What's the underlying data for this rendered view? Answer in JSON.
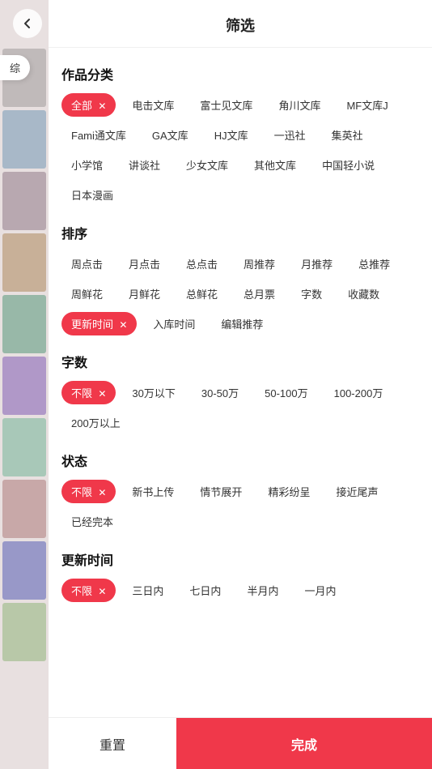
{
  "header": {
    "title": "筛选",
    "back_label": "‹"
  },
  "tab": {
    "label": "综"
  },
  "sections": {
    "category": {
      "title": "作品分类",
      "tags": [
        {
          "label": "全部",
          "active": true,
          "id": "all"
        },
        {
          "label": "电击文库",
          "active": false,
          "id": "dianji"
        },
        {
          "label": "富士见文库",
          "active": false,
          "id": "fuji"
        },
        {
          "label": "角川文库",
          "active": false,
          "id": "jiaochu"
        },
        {
          "label": "MF文库J",
          "active": false,
          "id": "mfj"
        },
        {
          "label": "Fami通文库",
          "active": false,
          "id": "fami"
        },
        {
          "label": "GA文库",
          "active": false,
          "id": "ga"
        },
        {
          "label": "HJ文库",
          "active": false,
          "id": "hj"
        },
        {
          "label": "一迅社",
          "active": false,
          "id": "yixun"
        },
        {
          "label": "集英社",
          "active": false,
          "id": "jiying"
        },
        {
          "label": "小学馆",
          "active": false,
          "id": "xiaoxue"
        },
        {
          "label": "讲谈社",
          "active": false,
          "id": "jiangtan"
        },
        {
          "label": "少女文库",
          "active": false,
          "id": "shaonv"
        },
        {
          "label": "其他文库",
          "active": false,
          "id": "qita"
        },
        {
          "label": "中国轻小说",
          "active": false,
          "id": "china"
        },
        {
          "label": "日本漫画",
          "active": false,
          "id": "manga"
        }
      ]
    },
    "sort": {
      "title": "排序",
      "tags": [
        {
          "label": "周点击",
          "active": false,
          "id": "week-click"
        },
        {
          "label": "月点击",
          "active": false,
          "id": "month-click"
        },
        {
          "label": "总点击",
          "active": false,
          "id": "total-click"
        },
        {
          "label": "周推荐",
          "active": false,
          "id": "week-rec"
        },
        {
          "label": "月推荐",
          "active": false,
          "id": "month-rec"
        },
        {
          "label": "总推荐",
          "active": false,
          "id": "total-rec"
        },
        {
          "label": "周鲜花",
          "active": false,
          "id": "week-flower"
        },
        {
          "label": "月鲜花",
          "active": false,
          "id": "month-flower"
        },
        {
          "label": "总鲜花",
          "active": false,
          "id": "total-flower"
        },
        {
          "label": "总月票",
          "active": false,
          "id": "total-ticket"
        },
        {
          "label": "字数",
          "active": false,
          "id": "wordcount"
        },
        {
          "label": "收藏数",
          "active": false,
          "id": "favorites"
        },
        {
          "label": "更新时间",
          "active": true,
          "id": "update-time"
        },
        {
          "label": "入库时间",
          "active": false,
          "id": "add-time"
        },
        {
          "label": "编辑推荐",
          "active": false,
          "id": "editor-rec"
        }
      ]
    },
    "wordcount": {
      "title": "字数",
      "tags": [
        {
          "label": "不限",
          "active": true,
          "id": "wc-all"
        },
        {
          "label": "30万以下",
          "active": false,
          "id": "wc-30"
        },
        {
          "label": "30-50万",
          "active": false,
          "id": "wc-30-50"
        },
        {
          "label": "50-100万",
          "active": false,
          "id": "wc-50-100"
        },
        {
          "label": "100-200万",
          "active": false,
          "id": "wc-100-200"
        },
        {
          "label": "200万以上",
          "active": false,
          "id": "wc-200"
        }
      ]
    },
    "status": {
      "title": "状态",
      "tags": [
        {
          "label": "不限",
          "active": true,
          "id": "st-all"
        },
        {
          "label": "新书上传",
          "active": false,
          "id": "st-new"
        },
        {
          "label": "情节展开",
          "active": false,
          "id": "st-plot"
        },
        {
          "label": "精彩纷呈",
          "active": false,
          "id": "st-exciting"
        },
        {
          "label": "接近尾声",
          "active": false,
          "id": "st-ending"
        },
        {
          "label": "已经完本",
          "active": false,
          "id": "st-complete"
        }
      ]
    },
    "update_time": {
      "title": "更新时间",
      "tags": [
        {
          "label": "不限",
          "active": true,
          "id": "ut-all"
        },
        {
          "label": "三日内",
          "active": false,
          "id": "ut-3"
        },
        {
          "label": "七日内",
          "active": false,
          "id": "ut-7"
        },
        {
          "label": "半月内",
          "active": false,
          "id": "ut-15"
        },
        {
          "label": "一月内",
          "active": false,
          "id": "ut-30"
        }
      ]
    }
  },
  "footer": {
    "reset_label": "重置",
    "confirm_label": "完成"
  },
  "books": [
    {
      "color": "#c0baba"
    },
    {
      "color": "#a8b8c8"
    },
    {
      "color": "#b8a8b0"
    },
    {
      "color": "#c8b098"
    },
    {
      "color": "#98b8a8"
    },
    {
      "color": "#b098c8"
    },
    {
      "color": "#a8c8b8"
    },
    {
      "color": "#c8a8a8"
    },
    {
      "color": "#9898c8"
    },
    {
      "color": "#b8c8a8"
    }
  ]
}
